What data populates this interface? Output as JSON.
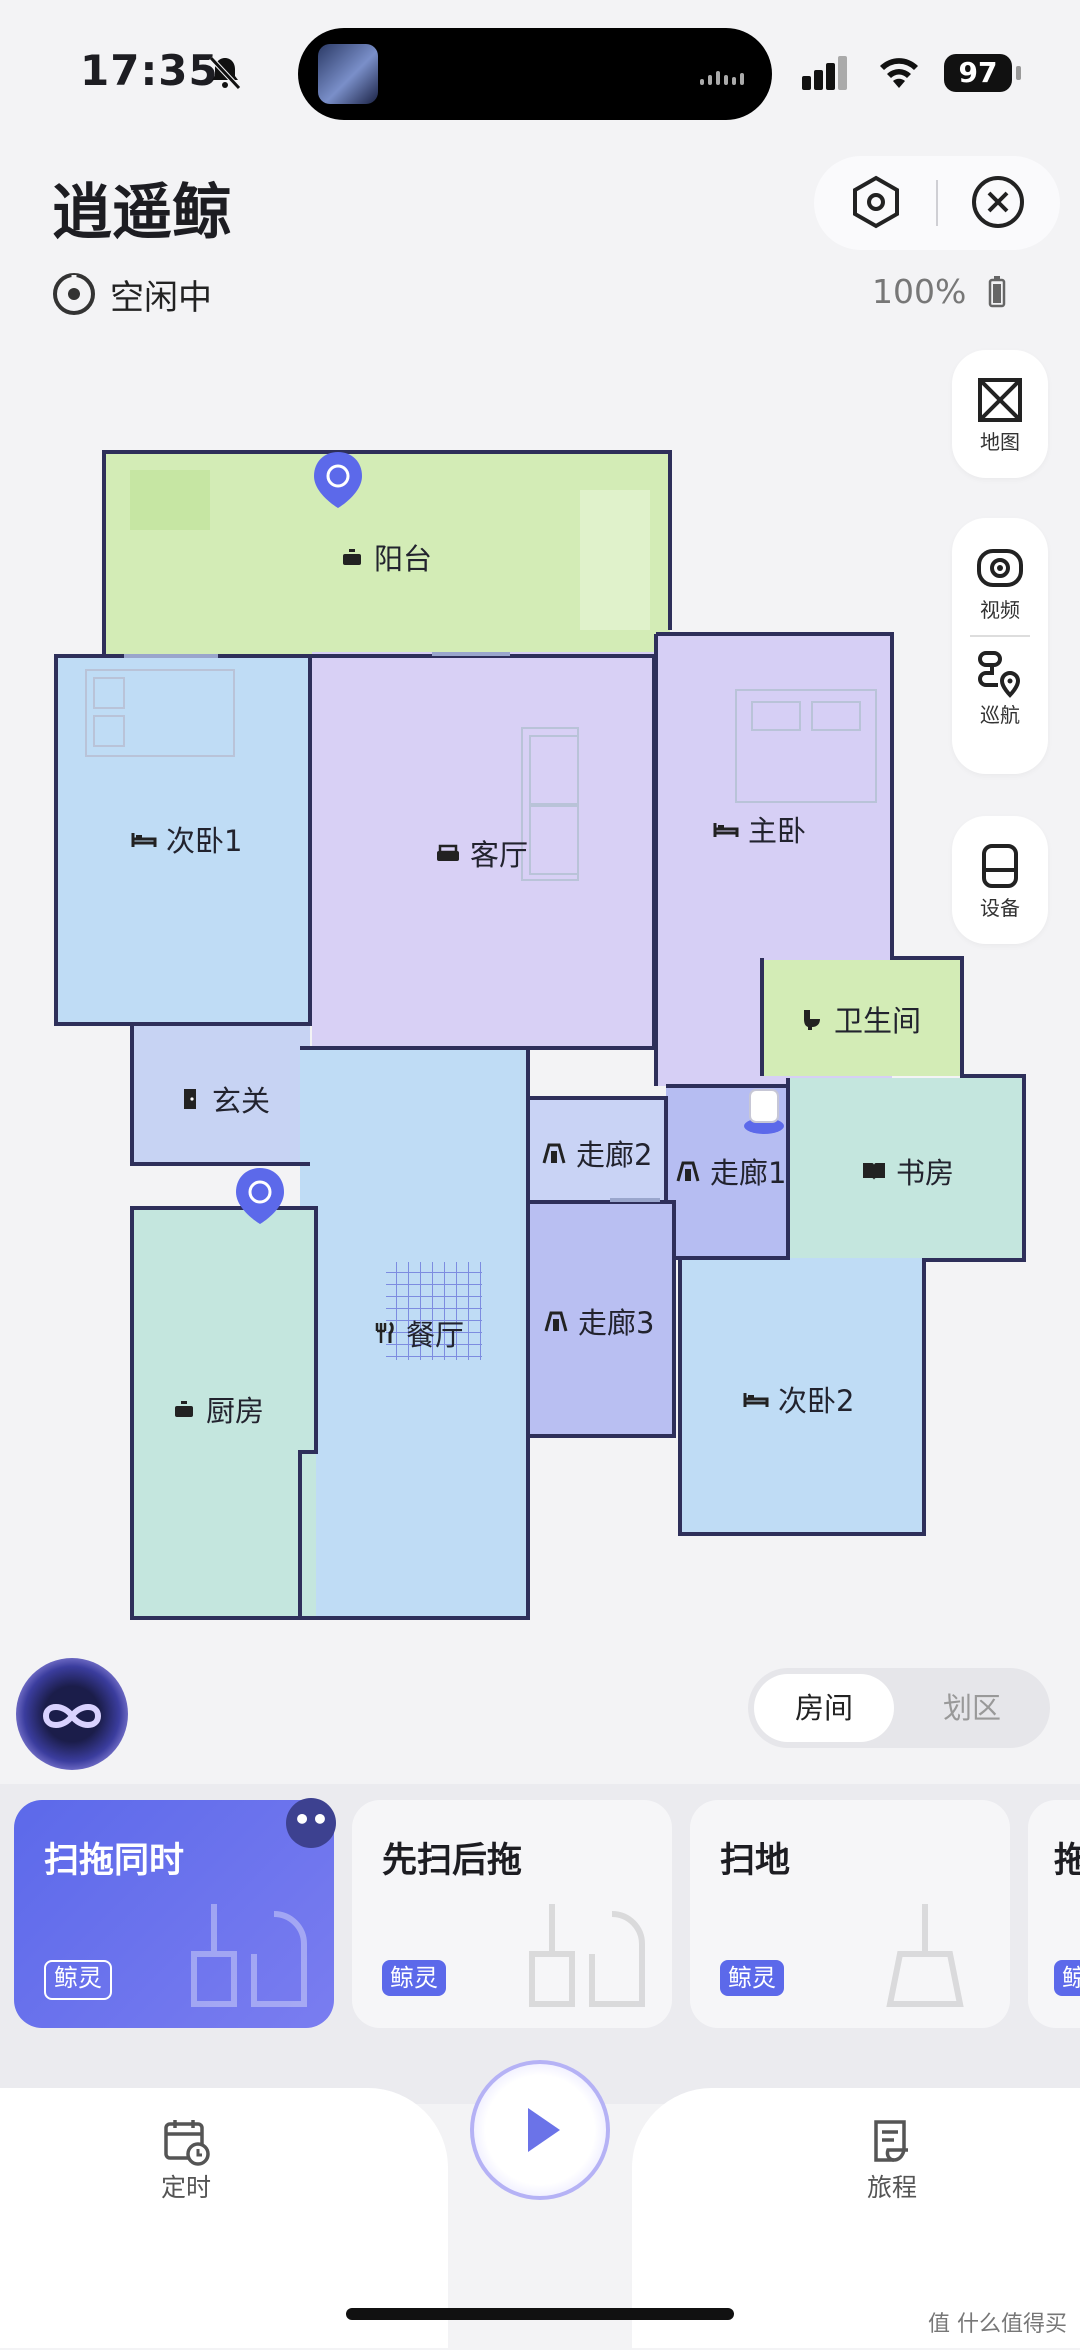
{
  "status_bar": {
    "time": "17:35",
    "battery": "97"
  },
  "header": {
    "title": "逍遥鲸",
    "status": "空闲中",
    "battery_percent": "100%"
  },
  "toolbar": {
    "map": "地图",
    "video": "视频",
    "patrol": "巡航",
    "device": "设备"
  },
  "rooms": [
    {
      "id": "balcony",
      "name": "阳台",
      "icon": "pot-icon"
    },
    {
      "id": "bedroom2",
      "name": "次卧1",
      "icon": "bed-icon"
    },
    {
      "id": "living",
      "name": "客厅",
      "icon": "sofa-icon"
    },
    {
      "id": "master",
      "name": "主卧",
      "icon": "bed-icon"
    },
    {
      "id": "bathroom",
      "name": "卫生间",
      "icon": "toilet-icon"
    },
    {
      "id": "entry",
      "name": "玄关",
      "icon": "door-icon"
    },
    {
      "id": "hall2",
      "name": "走廊2",
      "icon": "corridor-icon"
    },
    {
      "id": "hall1",
      "name": "走廊1",
      "icon": "corridor-icon"
    },
    {
      "id": "study",
      "name": "书房",
      "icon": "book-icon"
    },
    {
      "id": "hall3",
      "name": "走廊3",
      "icon": "corridor-icon"
    },
    {
      "id": "dining",
      "name": "餐厅",
      "icon": "utensils-icon"
    },
    {
      "id": "kitchen",
      "name": "厨房",
      "icon": "pot-icon"
    },
    {
      "id": "bedroom3",
      "name": "次卧2",
      "icon": "bed-icon"
    }
  ],
  "segment": {
    "rooms": "房间",
    "zones": "划区"
  },
  "modes": [
    {
      "title": "扫拖同时",
      "badge": "鲸灵"
    },
    {
      "title": "先扫后拖",
      "badge": "鲸灵"
    },
    {
      "title": "扫地",
      "badge": "鲸灵"
    },
    {
      "title": "拖",
      "badge": "鲸"
    }
  ],
  "nav": {
    "schedule": "定时",
    "journey": "旅程"
  },
  "watermark": "值 什么值得买",
  "colors": {
    "accent": "#5c69ea",
    "wall": "#2e2f5a",
    "balcony": "#d3ecb6",
    "bedroom": "#bfdcf5",
    "living": "#d8d0f5",
    "kitchen": "#c4e6de"
  }
}
